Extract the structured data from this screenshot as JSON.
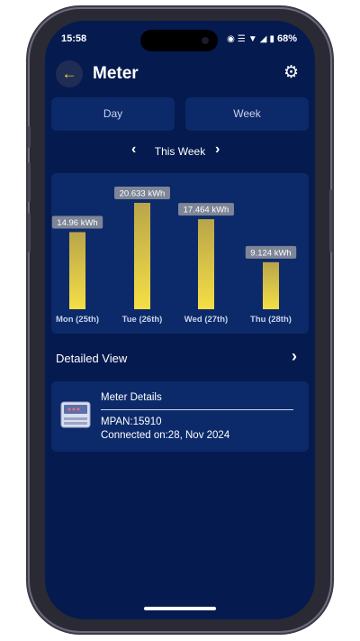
{
  "status_bar": {
    "time": "15:58",
    "battery": "68%",
    "icons": [
      "eye-icon",
      "vibrate-icon",
      "wifi-icon",
      "signal-icon",
      "battery-icon"
    ]
  },
  "header": {
    "title": "Meter",
    "back_icon": "arrow-left-icon",
    "settings_icon": "gear-icon"
  },
  "tabs": [
    {
      "label": "Day"
    },
    {
      "label": "Week"
    }
  ],
  "period_nav": {
    "label": "This Week"
  },
  "chart_data": {
    "type": "bar",
    "categories": [
      "Mon (25th)",
      "Tue (26th)",
      "Wed (27th)",
      "Thu (28th)"
    ],
    "values": [
      14.96,
      20.633,
      17.464,
      9.124
    ],
    "data_labels": [
      "14.96 kWh",
      "20.633 kWh",
      "17.464 kWh",
      "9.124 kWh"
    ],
    "title": "",
    "xlabel": "",
    "ylabel": "",
    "ylim": [
      0,
      20.633
    ],
    "grid": false,
    "bar_color_top": "#b9a54a",
    "bar_color_bottom": "#f5df45"
  },
  "detailed_view": {
    "label": "Detailed View"
  },
  "meter": {
    "title": "Meter Details",
    "mpan": "MPAN:15910",
    "connected": "Connected on:28, Nov 2024"
  },
  "colors": {
    "background": "#051a4f",
    "card": "#0c2a6a",
    "accent": "#f2d640"
  }
}
